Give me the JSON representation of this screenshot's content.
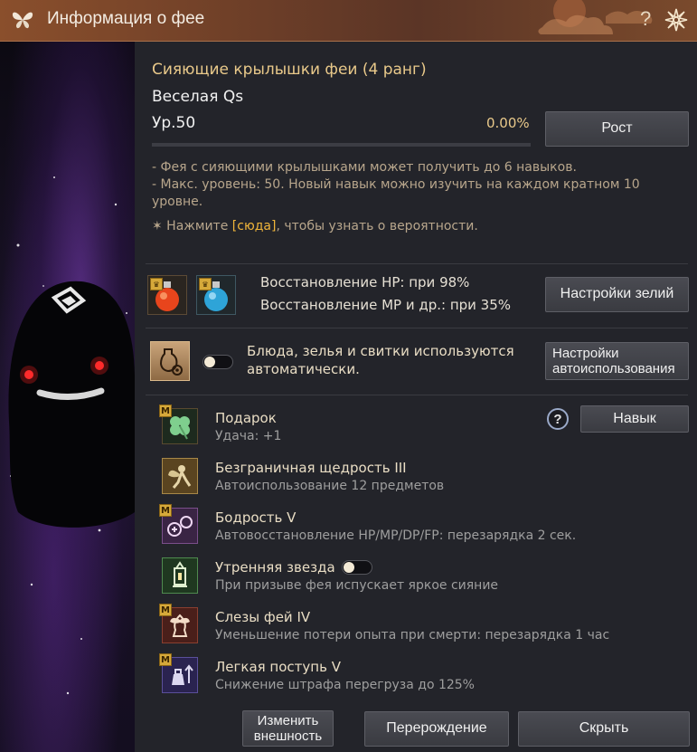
{
  "window": {
    "title": "Информация о фее",
    "help": "?"
  },
  "fairy": {
    "name": "Сияющие крылышки феи (4 ранг)",
    "nickname": "Веселая Qs",
    "level": "Ур.50",
    "exp_percent": "0.00%",
    "exp_fraction": 0.0,
    "grow_button": "Рост",
    "desc_line1": "- Фея с сияющими крылышками может получить до 6 навыков.",
    "desc_line2": "- Макс. уровень: 50. Новый навык можно изучить на каждом кратном 10",
    "desc_line3": "уровне.",
    "hint_prefix": "✶ Нажмите ",
    "hint_link": "[сюда]",
    "hint_suffix": ", чтобы узнать о вероятности."
  },
  "potions": {
    "hp_text": "Восстановление HP: при 98%",
    "mp_text": "Восстановление MP и др.: при 35%",
    "settings_button": "Настройки зелий"
  },
  "auto_use": {
    "text_line1": "Блюда, зелья и свитки используются",
    "text_line2": "автоматически.",
    "settings_line1": "Настройки",
    "settings_line2": "автоиспользования",
    "enabled": false
  },
  "skills_panel": {
    "help": "?",
    "skill_button": "Навык",
    "badge": "M"
  },
  "skills": [
    {
      "name": "Подарок",
      "desc": "Удача: +1"
    },
    {
      "name": "Безграничная щедрость III",
      "desc": "Автоиспользование 12 предметов"
    },
    {
      "name": "Бодрость V",
      "desc": "Автовосстановление HP/MP/DP/FP: перезарядка 2 сек."
    },
    {
      "name": "Утренняя звезда",
      "desc": "При призыве фея испускает яркое сияние",
      "toggle": false
    },
    {
      "name": "Слезы фей IV",
      "desc": "Уменьшение потери опыта при смерти: перезарядка 1 час"
    },
    {
      "name": "Легкая поступь V",
      "desc": "Снижение штрафа перегруза до 125%"
    }
  ],
  "footer": {
    "change_look_line1": "Изменить",
    "change_look_line2": "внешность",
    "rebirth": "Перерождение",
    "hide": "Скрыть"
  },
  "colors": {
    "accent_gold": "#e9c98a",
    "link": "#f0b53a",
    "title_bar": "#7a4a2c"
  }
}
